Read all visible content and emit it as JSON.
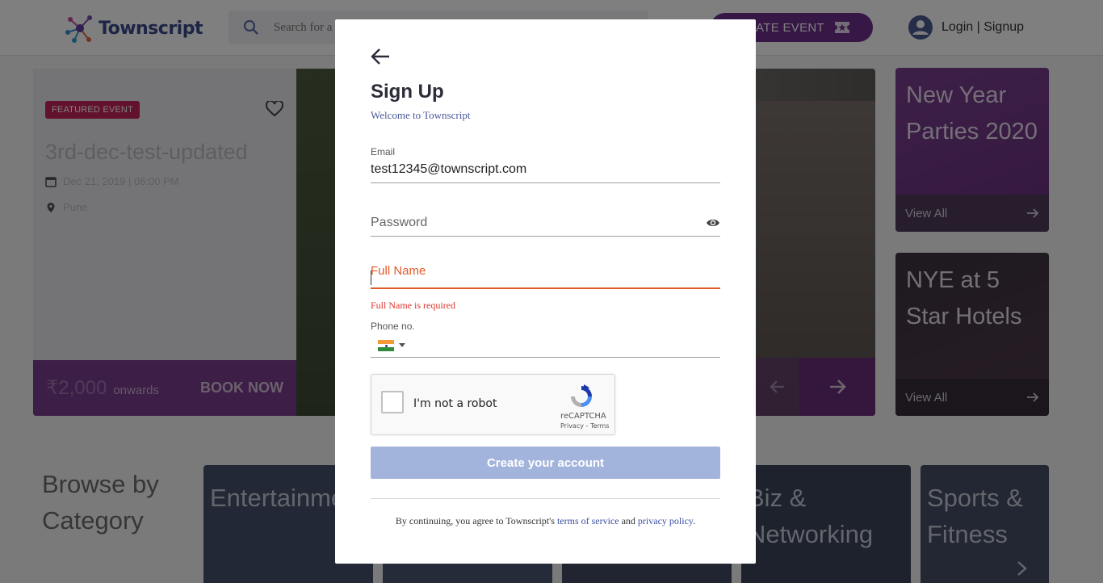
{
  "header": {
    "logo_text": "Townscript",
    "search_placeholder": "Search for a",
    "create_event_label": "EATE EVENT",
    "login_label": "Login | Signup"
  },
  "hero": {
    "badge": "FEATURED EVENT",
    "title": "3rd-dec-test-updated",
    "date": "Dec 21, 2019 | 06:00 PM",
    "location": "Pune",
    "price": "₹2,000",
    "onwards": "onwards",
    "book_now": "BOOK NOW"
  },
  "side_cards": [
    {
      "title": "New Year Parties 2020",
      "link": "View All"
    },
    {
      "title": "NYE at 5 Star Hotels",
      "link": "View All"
    }
  ],
  "browse": {
    "title": "Browse by Category",
    "categories": [
      {
        "title": "Entertainment"
      },
      {
        "title": ""
      },
      {
        "title": ""
      },
      {
        "title": "Biz & Networking"
      },
      {
        "title": "Sports & Fitness"
      }
    ]
  },
  "modal": {
    "title": "Sign Up",
    "subtitle": "Welcome to Townscript",
    "email": {
      "label": "Email",
      "value": "test12345@townscript.com"
    },
    "password": {
      "placeholder": "Password"
    },
    "full_name": {
      "label": "Full Name",
      "error": "Full Name is required"
    },
    "phone": {
      "label": "Phone no.",
      "value": ""
    },
    "recaptcha": {
      "label": "I'm not a robot",
      "brand": "reCAPTCHA",
      "links": "Privacy - Terms"
    },
    "submit_label": "Create your account",
    "terms": {
      "prefix": "By continuing, you agree to Townscript's ",
      "tos": "terms of service",
      "and": " and ",
      "privacy": "privacy policy",
      "suffix": "."
    }
  },
  "colors": {
    "brand_purple": "#6e2e8c",
    "error_orange": "#e05a29",
    "disabled_button": "#a2b3dc",
    "link_blue": "#3b4fa3"
  }
}
